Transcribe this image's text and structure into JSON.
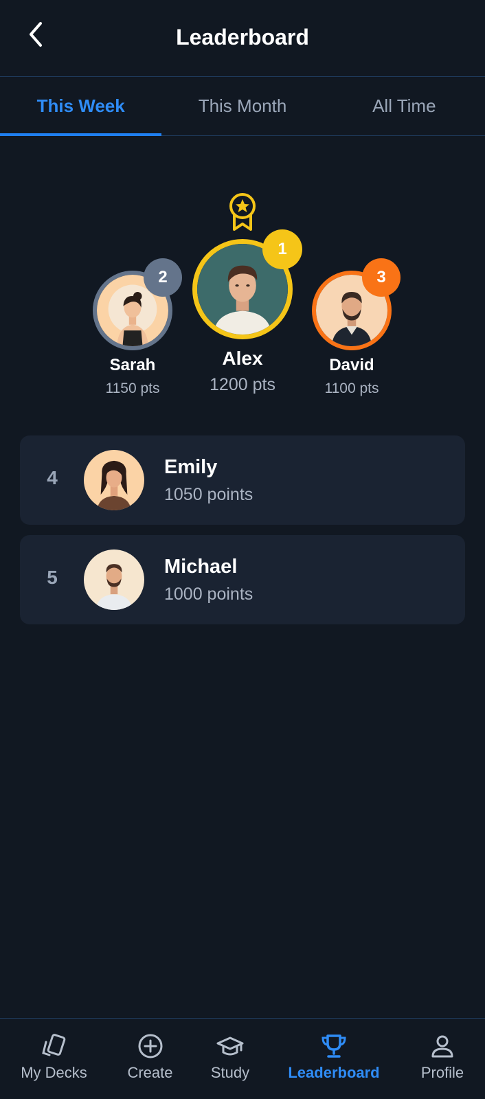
{
  "header": {
    "title": "Leaderboard"
  },
  "tabs": [
    {
      "label": "This Week",
      "active": true
    },
    {
      "label": "This Month",
      "active": false
    },
    {
      "label": "All Time",
      "active": false
    }
  ],
  "podium": {
    "first": {
      "rank": "1",
      "name": "Alex",
      "points": "1200 pts",
      "ring_color": "#f5c518"
    },
    "second": {
      "rank": "2",
      "name": "Sarah",
      "points": "1150 pts",
      "ring_color": "#64748b"
    },
    "third": {
      "rank": "3",
      "name": "David",
      "points": "1100 pts",
      "ring_color": "#f97316"
    }
  },
  "list": [
    {
      "rank": "4",
      "name": "Emily",
      "points": "1050 points"
    },
    {
      "rank": "5",
      "name": "Michael",
      "points": "1000 points"
    }
  ],
  "nav": {
    "items": [
      {
        "label": "My Decks",
        "icon": "cards-icon"
      },
      {
        "label": "Create",
        "icon": "plus-circle-icon"
      },
      {
        "label": "Study",
        "icon": "graduation-cap-icon"
      },
      {
        "label": "Leaderboard",
        "icon": "trophy-icon",
        "active": true
      },
      {
        "label": "Profile",
        "icon": "user-icon"
      }
    ]
  },
  "colors": {
    "accent": "#2f8cf6",
    "background": "#111822",
    "card": "#1a2332",
    "gold": "#f5c518",
    "orange": "#f97316",
    "silver": "#64748b"
  }
}
